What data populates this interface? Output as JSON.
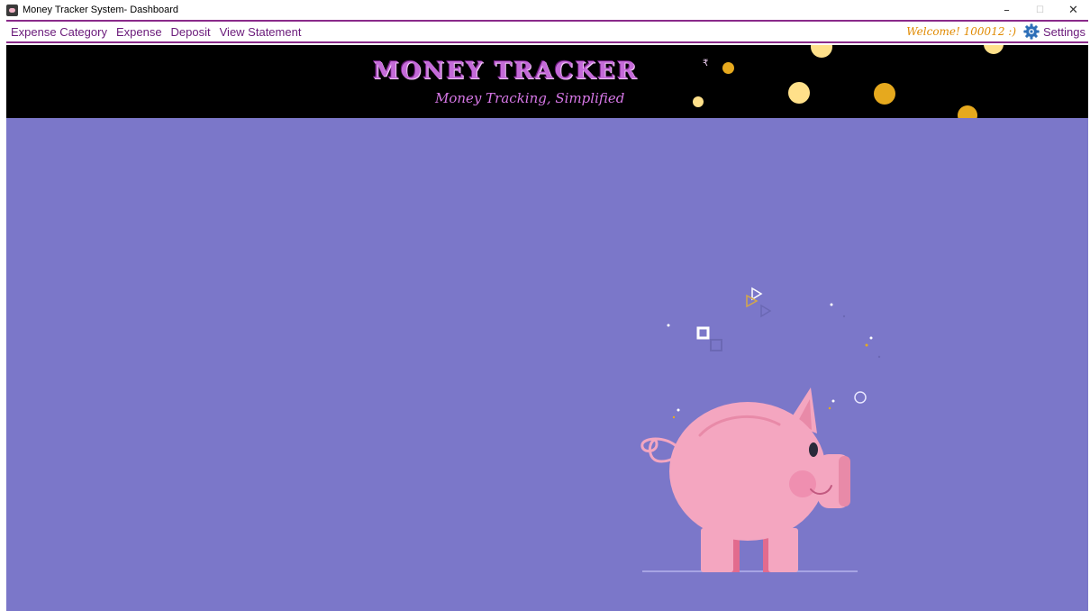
{
  "window": {
    "title": "Money Tracker System- Dashboard",
    "controls": {
      "minimize": "–",
      "maximize": "☐",
      "close": "✕"
    }
  },
  "menu": {
    "items": [
      {
        "label": "Expense Category"
      },
      {
        "label": "Expense"
      },
      {
        "label": "Deposit"
      },
      {
        "label": "View Statement"
      }
    ],
    "welcome": "Welcome! 100012 :)",
    "settings_label": "Settings"
  },
  "banner": {
    "title": "MONEY TRACKER",
    "rupee": "₹",
    "tagline": "Money Tracking, Simplified"
  },
  "colors": {
    "menu_border": "#8a2a8a",
    "menu_text": "#6a1a7a",
    "welcome_text": "#e08a00",
    "banner_bg": "#000000",
    "content_bg": "#7b77c9",
    "pig": "#f4a6c0"
  },
  "icons": {
    "app": "piggy-app-icon",
    "settings": "gear-icon",
    "illustration": "piggy-bank-icon"
  }
}
